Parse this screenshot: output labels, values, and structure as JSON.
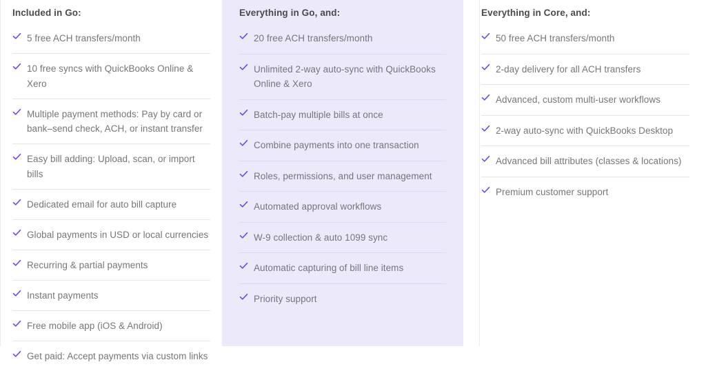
{
  "theme": {
    "check_color": "#6d3cf5",
    "highlight_panel_bg": "#ece9fb",
    "page_bg": "#ffffff",
    "heading_color": "#4a4a4a",
    "item_text_color": "#74767a",
    "divider_color": "#e6e4e4"
  },
  "columns": [
    {
      "id": "go",
      "heading": "Included in Go:",
      "highlighted": false,
      "features": [
        "5 free ACH transfers/month",
        "10 free syncs with QuickBooks Online & Xero",
        "Multiple payment methods: Pay by card or bank–send check, ACH, or instant transfer",
        "Easy bill adding: Upload, scan, or import bills",
        "Dedicated email for auto bill capture",
        "Global payments in USD or local currencies",
        "Recurring & partial payments",
        "Instant payments",
        "Free mobile app (iOS & Android)",
        "Get paid: Accept payments via custom links"
      ]
    },
    {
      "id": "core",
      "heading": "Everything in Go, and:",
      "highlighted": true,
      "features": [
        "20 free ACH transfers/month",
        "Unlimited 2-way auto-sync with QuickBooks Online & Xero",
        "Batch-pay multiple bills at once",
        "Combine payments into one transaction",
        "Roles, permissions, and user management",
        "Automated approval workflows",
        "W-9 collection & auto 1099 sync",
        "Automatic capturing of bill line items",
        "Priority support"
      ]
    },
    {
      "id": "premium",
      "heading": "Everything in Core, and:",
      "highlighted": false,
      "features": [
        "50 free ACH transfers/month",
        "2-day delivery for all ACH transfers",
        "Advanced, custom multi-user workflows",
        "2-way auto-sync with QuickBooks Desktop",
        "Advanced bill attributes (classes & locations)",
        "Premium customer support"
      ]
    }
  ],
  "icons": {
    "check": "check-icon"
  }
}
